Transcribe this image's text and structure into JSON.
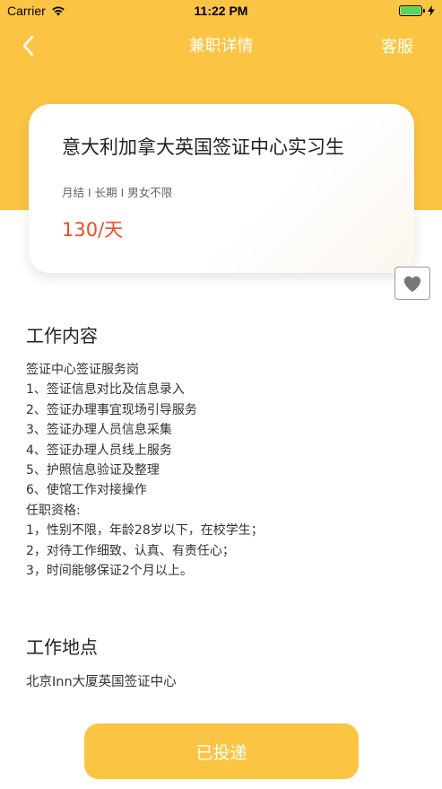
{
  "status_bar": {
    "carrier": "Carrier",
    "time": "11:22 PM"
  },
  "nav": {
    "title": "兼职详情",
    "service": "客服"
  },
  "job": {
    "title": "意大利加拿大英国签证中心实习生",
    "tags": "月结 I 长期 I 男女不限",
    "salary": "130/天"
  },
  "work_content": {
    "title": "工作内容",
    "lines": [
      "签证中心签证服务岗",
      "1、签证信息对比及信息录入",
      "2、签证办理事宜现场引导服务",
      "3、签证办理人员信息采集",
      "4、签证办理人员线上服务",
      "5、护照信息验证及整理",
      "6、使馆工作对接操作",
      "任职资格:",
      "1，性别不限，年龄28岁以下，在校学生；",
      "2，对待工作细致、认真、有责任心；",
      "3，时间能够保证2个月以上。"
    ]
  },
  "work_location": {
    "title": "工作地点",
    "address": "北京Inn大厦英国签证中心"
  },
  "apply_button": {
    "label": "已投递"
  },
  "colors": {
    "accent": "#fcc443",
    "salary": "#f24b2b"
  },
  "icons": {
    "back": "chevron-left-icon",
    "favorite": "heart-icon",
    "wifi": "wifi-icon",
    "battery": "battery-icon"
  }
}
